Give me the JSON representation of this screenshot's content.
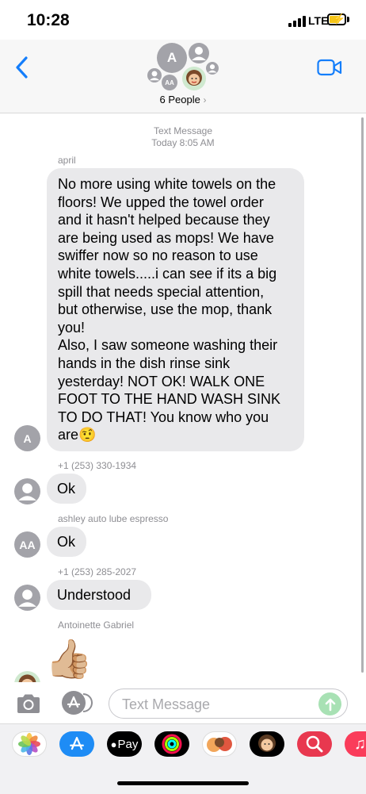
{
  "status_bar": {
    "time": "10:28",
    "network": "LTE"
  },
  "header": {
    "group_avatar_letter": "A",
    "group_avatar_initials": "AA",
    "group_title": "6 People",
    "group_chevron": "›"
  },
  "conversation": {
    "service_label": "Text Message",
    "timestamp": "Today 8:05 AM",
    "messages": [
      {
        "sender": "april",
        "avatar": "A",
        "lines": [
          "No more using white towels on the",
          "floors! We upped the towel order",
          "and it hasn't helped because  they",
          "are being used as mops! We have",
          "swiffer now so no reason to use",
          "white towels.....i can see if its a big",
          "spill that needs special attention,",
          "but otherwise, use the mop, thank",
          "you!",
          "Also, I saw someone washing their",
          "hands in the dish rinse sink",
          "yesterday! NOT OK! WALK ONE",
          "FOOT TO THE HAND WASH SINK",
          "TO DO THAT! You know who you",
          "are🤨"
        ]
      },
      {
        "sender": "+1 (253) 330-1934",
        "avatar": "",
        "text": "Ok"
      },
      {
        "sender": "ashley auto lube espresso",
        "avatar": "AA",
        "text": "Ok"
      },
      {
        "sender": "+1 (253) 285-2027",
        "avatar": "",
        "text": "Understood"
      },
      {
        "sender": "Antoinette Gabriel",
        "avatar": "",
        "text": "👍🏼"
      }
    ]
  },
  "input": {
    "placeholder": "Text Message"
  },
  "app_drawer": {
    "apps": [
      {
        "name": "photos-app-icon",
        "label": ""
      },
      {
        "name": "app-store-app-icon",
        "label": ""
      },
      {
        "name": "apple-pay-app-icon",
        "label": "Pay"
      },
      {
        "name": "activity-app-icon",
        "label": ""
      },
      {
        "name": "memoji-stickers-app-icon",
        "label": ""
      },
      {
        "name": "animoji-app-icon",
        "label": ""
      },
      {
        "name": "image-search-app-icon",
        "label": ""
      },
      {
        "name": "music-app-icon",
        "label": "♫"
      }
    ]
  },
  "colors": {
    "accent": "#147efb",
    "bubble": "#e9e9eb",
    "send": "#a8e1b4",
    "avatar": "#a3a3a9"
  }
}
